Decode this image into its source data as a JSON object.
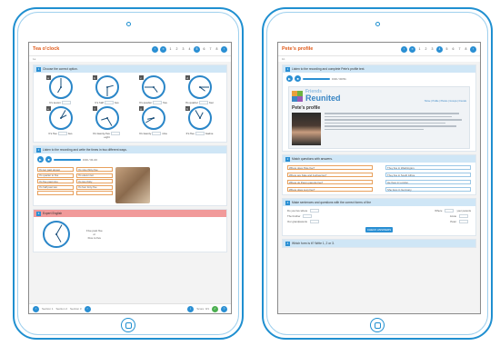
{
  "left": {
    "title": "Tea o'clock",
    "subtitle": "1a",
    "pages": [
      "1",
      "2",
      "3",
      "4",
      "5",
      "6",
      "7",
      "8"
    ],
    "active_page": "5",
    "section1": {
      "num": "1",
      "title": "Choose the correct option."
    },
    "clocks": [
      {
        "tag": "a",
        "pre": "It's seven",
        "post": "",
        "hour": 7,
        "minute": 0
      },
      {
        "tag": "b",
        "pre": "It's half",
        "post": "two",
        "hour": 2,
        "minute": 30
      },
      {
        "tag": "c",
        "pre": "It's quarter",
        "post": "five",
        "hour": 4,
        "minute": 45
      },
      {
        "tag": "d",
        "pre": "It's quarter",
        "post": "four",
        "hour": 4,
        "minute": 15
      },
      {
        "tag": "e",
        "pre": "It's five",
        "post": "two",
        "hour": 2,
        "minute": 5
      },
      {
        "tag": "f",
        "pre": "It's twenty-five",
        "post": "",
        "hour": 8,
        "minute": 25
      },
      {
        "tag": "g",
        "pre": "It's twenty",
        "post": "nine",
        "hour": 8,
        "minute": 40
      },
      {
        "tag": "h",
        "pre": "It's five",
        "post": "twelve",
        "hour": 12,
        "minute": 55
      }
    ],
    "clock_extra": "eight",
    "section2": {
      "num": "2",
      "title": "Listen to the recording and write the times in two different ways."
    },
    "audio_time": "0:00 / 01:23",
    "phrases_left": [
      "It's ten past eleven",
      "It's quarter to five",
      "It's five past nine",
      "It's half past two",
      ""
    ],
    "phrases_right": [
      "It's nine thirty-five",
      "It's eleven ten",
      "It's two thirty",
      "It's four forty-five",
      ""
    ],
    "section3": {
      "num": "3",
      "title": "Expert English"
    },
    "expert_lines": [
      "Five past five",
      "or",
      "Five to five"
    ],
    "bottom": {
      "items": [
        "Section 1",
        "Section 2",
        "Section 3"
      ],
      "right": "Score: 0/1"
    }
  },
  "right": {
    "title": "Pete's profile",
    "subtitle": "1b",
    "pages": [
      "1",
      "2",
      "3",
      "4",
      "5",
      "6",
      "7",
      "8"
    ],
    "active_page": "4",
    "section1": {
      "num": "1",
      "title": "Listen to the recording and complete Pete's profile text."
    },
    "audio_time": "0:00 / 00:51",
    "logo_top": "Friends",
    "logo_main": "Reunited",
    "site_nav": "Home  |  Profile  |  Photos  |  Groups  |  Friends",
    "profile_title": "Pete's profile",
    "section2": {
      "num": "2",
      "title": "Match questions with answers."
    },
    "questions": [
      "Where does Pete live?",
      "Where are Kate and Joshua live?",
      "Where do Pete's parents live?",
      "Where does Lucy live?"
    ],
    "answers": [
      "They live in Washington.",
      "They live in South Africa.",
      "He lives in London.",
      "She lives in Germany."
    ],
    "section3": {
      "num": "3",
      "title": "Make sentences and questions with the correct forms of the"
    },
    "fills": [
      {
        "a": "Do you live where",
        "b": "Where",
        "c": "your parents"
      },
      {
        "a": "The brother",
        "b": "Annie",
        "c": ""
      },
      {
        "a": "Our grandparents",
        "b": "Peter",
        "c": ""
      }
    ],
    "check_btn": "CHECK ANSWERS",
    "section4": {
      "num": "4",
      "title": "Which form is it? Write 1, 2 or 3."
    }
  }
}
